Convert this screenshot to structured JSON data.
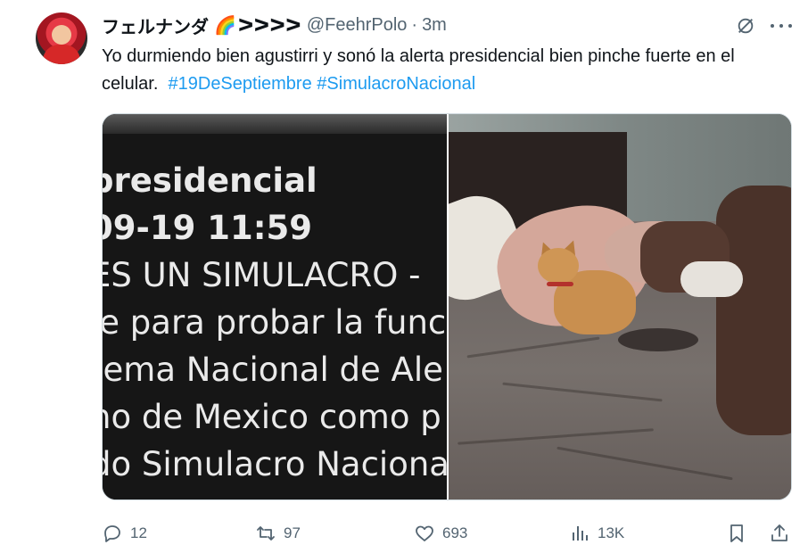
{
  "author": {
    "display_name": "フェルナンダ",
    "name_emoji": "🌈",
    "name_suffix": "ᐳᐳᐳᐳ",
    "handle": "@FeehrPolo",
    "separator": "·",
    "time": "3m"
  },
  "tweet": {
    "text": "Yo durmiendo bien agustirri y sonó la alerta presidencial bien pinche fuerte en el celular.",
    "hashtags": [
      "#19DeSeptiembre",
      "#SimulacroNacional"
    ]
  },
  "media": {
    "left_image_lines": [
      "presidencial",
      "09-19 11:59",
      "ES UN SIMULACRO -",
      "je para probar la func",
      "tema Nacional de Ale",
      "no de Mexico como p",
      "do Simulacro Naciona"
    ]
  },
  "actions": {
    "reply_count": "12",
    "repost_count": "97",
    "like_count": "693",
    "views_count": "13K"
  },
  "colors": {
    "text_primary": "#0f1419",
    "text_secondary": "#536471",
    "link": "#1d9bf0",
    "border": "#cfd9de"
  },
  "icons": {
    "grok": "grok-icon",
    "more": "more-icon",
    "reply": "reply-icon",
    "repost": "repost-icon",
    "like": "heart-icon",
    "views": "views-icon",
    "bookmark": "bookmark-icon",
    "share": "share-icon"
  }
}
